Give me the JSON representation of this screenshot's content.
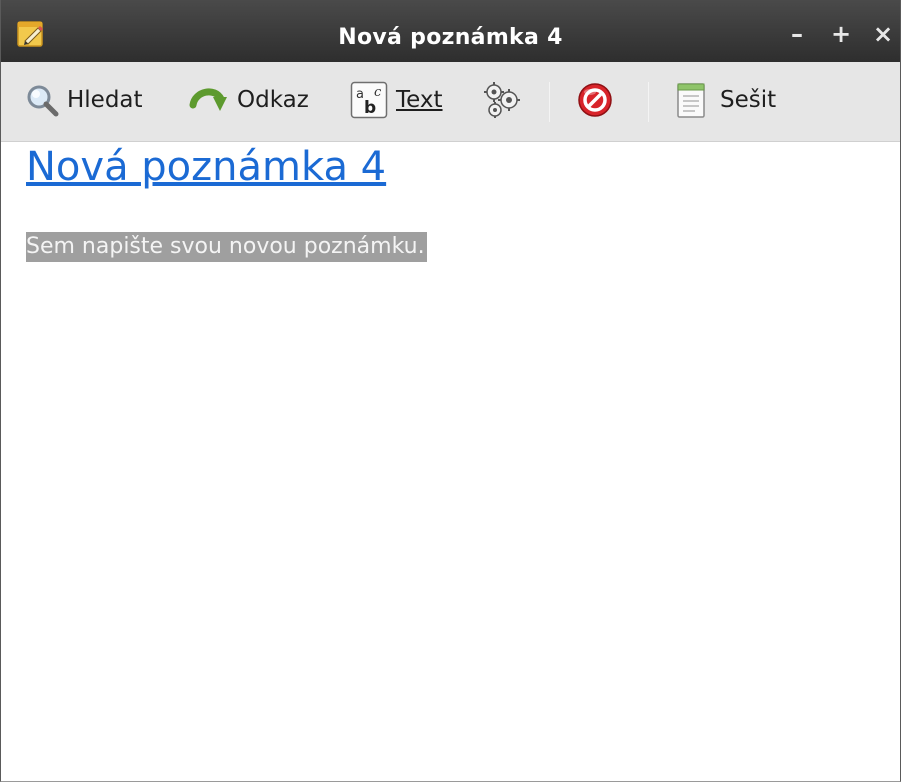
{
  "window": {
    "title": "Nová poznámka 4",
    "controls": {
      "minimize": "–",
      "maximize": "+",
      "close": "×"
    }
  },
  "toolbar": {
    "search": {
      "label": "Hledat",
      "icon": "magnifier-icon"
    },
    "link": {
      "label": "Odkaz",
      "icon": "green-arrow-icon"
    },
    "text": {
      "label": "Text",
      "icon": "text-format-icon"
    },
    "tools": {
      "icon": "gears-icon"
    },
    "delete": {
      "icon": "red-no-sign-icon"
    },
    "notebook": {
      "label": "Sešit",
      "icon": "notebook-icon"
    }
  },
  "note": {
    "title": "Nová poznámka 4",
    "body": "Sem napište svou novou poznámku."
  },
  "colors": {
    "titlebar": "#333333",
    "toolbar": "#e6e6e6",
    "title_link": "#1b6ad4",
    "selection_bg": "#9f9f9f",
    "delete_red": "#d8242a"
  }
}
